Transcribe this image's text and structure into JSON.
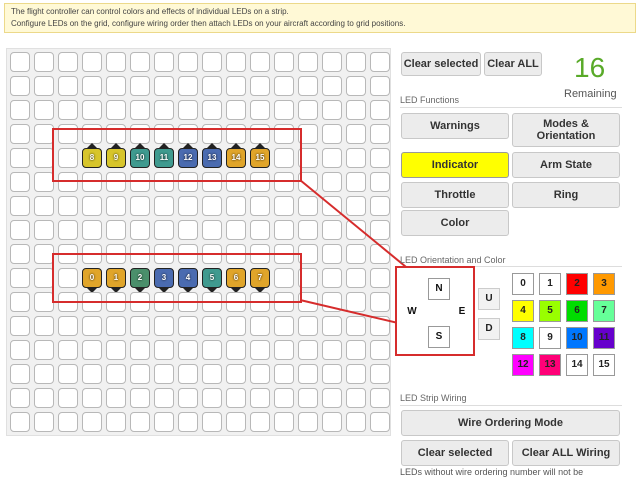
{
  "note": {
    "line1": "The flight controller can control colors and effects of individual LEDs on a strip.",
    "line2": "Configure LEDs on the grid, configure wiring order then attach LEDs on your aircraft according to grid positions."
  },
  "grid": {
    "columns": 16,
    "rows": 16,
    "leds": [
      {
        "col": 3,
        "row": 4,
        "num": "8",
        "color": "#d7c52b",
        "dir": "up"
      },
      {
        "col": 4,
        "row": 4,
        "num": "9",
        "color": "#d7c52b",
        "dir": "up"
      },
      {
        "col": 5,
        "row": 4,
        "num": "10",
        "color": "#3f9a8f",
        "dir": "up"
      },
      {
        "col": 6,
        "row": 4,
        "num": "11",
        "color": "#3f9a8f",
        "dir": "up"
      },
      {
        "col": 7,
        "row": 4,
        "num": "12",
        "color": "#4a6bb0",
        "dir": "up"
      },
      {
        "col": 8,
        "row": 4,
        "num": "13",
        "color": "#4a6bb0",
        "dir": "up"
      },
      {
        "col": 9,
        "row": 4,
        "num": "14",
        "color": "#e0a52a",
        "dir": "up"
      },
      {
        "col": 10,
        "row": 4,
        "num": "15",
        "color": "#e0a52a",
        "dir": "up"
      },
      {
        "col": 3,
        "row": 9,
        "num": "0",
        "color": "#e0a52a",
        "dir": "down"
      },
      {
        "col": 4,
        "row": 9,
        "num": "1",
        "color": "#e0a52a",
        "dir": "down"
      },
      {
        "col": 5,
        "row": 9,
        "num": "2",
        "color": "#4a8f6b",
        "dir": "down"
      },
      {
        "col": 6,
        "row": 9,
        "num": "3",
        "color": "#4a6bb0",
        "dir": "down"
      },
      {
        "col": 7,
        "row": 9,
        "num": "4",
        "color": "#4a6bb0",
        "dir": "down"
      },
      {
        "col": 8,
        "row": 9,
        "num": "5",
        "color": "#3f9a8f",
        "dir": "down"
      },
      {
        "col": 9,
        "row": 9,
        "num": "6",
        "color": "#e0a52a",
        "dir": "down"
      },
      {
        "col": 10,
        "row": 9,
        "num": "7",
        "color": "#e0a52a",
        "dir": "down"
      }
    ]
  },
  "toolbar": {
    "clear_selected": "Clear selected",
    "clear_all": "Clear ALL"
  },
  "remaining": {
    "count": "16",
    "label": "Remaining"
  },
  "functions": {
    "title": "LED Functions",
    "buttons": [
      {
        "label": "Warnings",
        "active": false
      },
      {
        "label": "Modes & Orientation",
        "active": false
      },
      {
        "label": "Indicator",
        "active": true
      },
      {
        "label": "Arm State",
        "active": false
      },
      {
        "label": "Throttle",
        "active": false
      },
      {
        "label": "Ring",
        "active": false
      },
      {
        "label": "Color",
        "active": false
      }
    ]
  },
  "orientation": {
    "title": "LED Orientation and Color",
    "north": "N",
    "south": "S",
    "west": "W",
    "east": "E",
    "up": "U",
    "down": "D"
  },
  "colors": [
    {
      "label": "0",
      "hex": "#ffffff"
    },
    {
      "label": "1",
      "hex": "#ffffff"
    },
    {
      "label": "2",
      "hex": "#ff0000"
    },
    {
      "label": "3",
      "hex": "#ff9900"
    },
    {
      "label": "4",
      "hex": "#ffff00"
    },
    {
      "label": "5",
      "hex": "#99ff00"
    },
    {
      "label": "6",
      "hex": "#00dd00"
    },
    {
      "label": "7",
      "hex": "#66ff99"
    },
    {
      "label": "8",
      "hex": "#00ffff"
    },
    {
      "label": "9",
      "hex": "#ffffff"
    },
    {
      "label": "10",
      "hex": "#0077ff"
    },
    {
      "label": "11",
      "hex": "#6600cc"
    },
    {
      "label": "12",
      "hex": "#ff00ff"
    },
    {
      "label": "13",
      "hex": "#ff0077"
    },
    {
      "label": "14",
      "hex": "#ffffff"
    },
    {
      "label": "15",
      "hex": "#ffffff"
    }
  ],
  "wiring": {
    "title": "LED Strip Wiring",
    "wire_ordering": "Wire Ordering Mode",
    "clear_selected": "Clear selected",
    "clear_all": "Clear ALL Wiring",
    "footnote": "LEDs without wire ordering number will not be"
  }
}
